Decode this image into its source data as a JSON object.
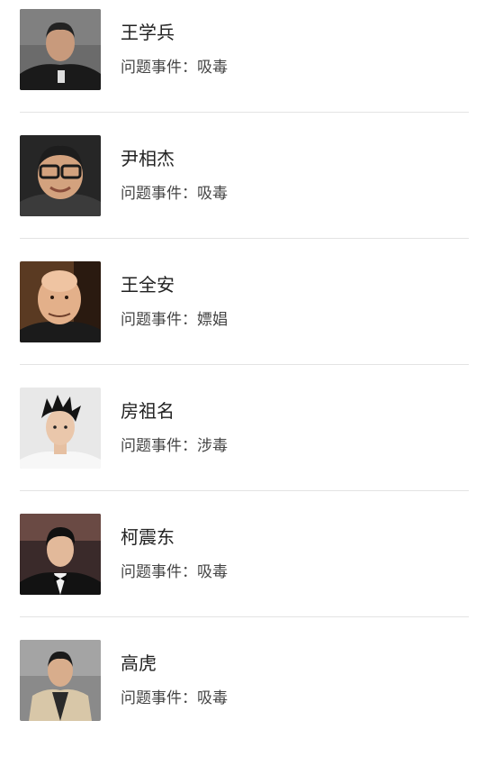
{
  "issue_label": "问题事件：",
  "people": [
    {
      "name": "王学兵",
      "issue": "吸毒"
    },
    {
      "name": "尹相杰",
      "issue": "吸毒"
    },
    {
      "name": "王全安",
      "issue": "嫖娼"
    },
    {
      "name": "房祖名",
      "issue": "涉毒"
    },
    {
      "name": "柯震东",
      "issue": "吸毒"
    },
    {
      "name": "高虎",
      "issue": "吸毒"
    }
  ]
}
